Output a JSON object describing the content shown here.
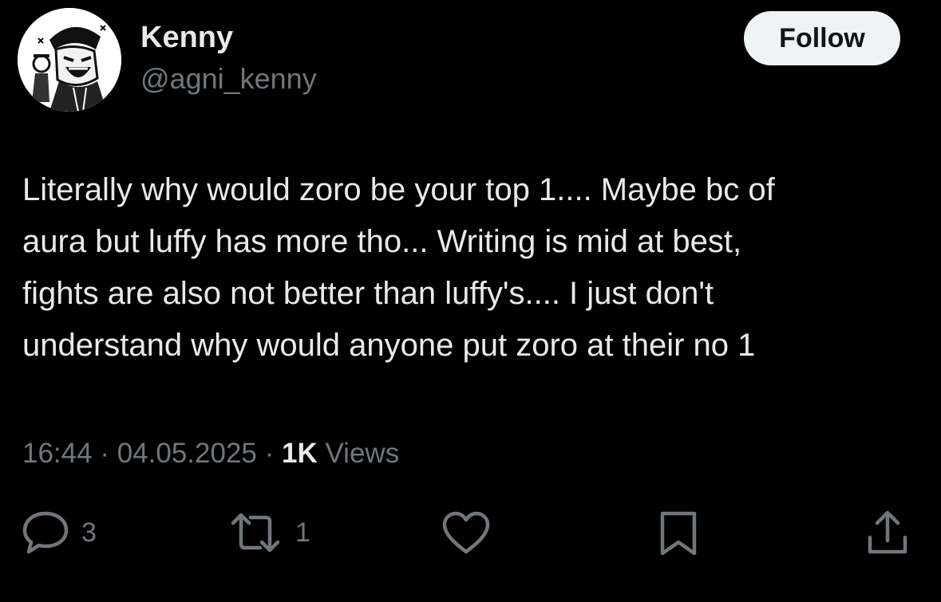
{
  "colors": {
    "background": "#000000",
    "primary_text": "#e7e9ea",
    "secondary_text": "#71767b",
    "follow_button_bg": "#eff3f4",
    "follow_button_text": "#0f1419"
  },
  "author": {
    "display_name": "Kenny",
    "handle": "@agni_kenny",
    "avatar_icon": "avatar-manga-character-icon"
  },
  "follow_button": {
    "label": "Follow"
  },
  "tweet": {
    "lines": [
      "Literally why would zoro be your top 1.... Maybe bc of",
      "aura but luffy has more tho... Writing is mid at best,",
      "fights are also not better than luffy's.... I just don't",
      "understand why would anyone put zoro at their no 1"
    ]
  },
  "meta": {
    "time": "16:44",
    "separator": " · ",
    "date": "04.05.2025",
    "views_count": "1K",
    "views_label": "Views"
  },
  "actions": {
    "reply": {
      "icon": "reply-icon",
      "count": "3"
    },
    "repost": {
      "icon": "repost-icon",
      "count": "1"
    },
    "like": {
      "icon": "heart-icon",
      "count": ""
    },
    "bookmark": {
      "icon": "bookmark-icon"
    },
    "share": {
      "icon": "share-icon"
    }
  }
}
